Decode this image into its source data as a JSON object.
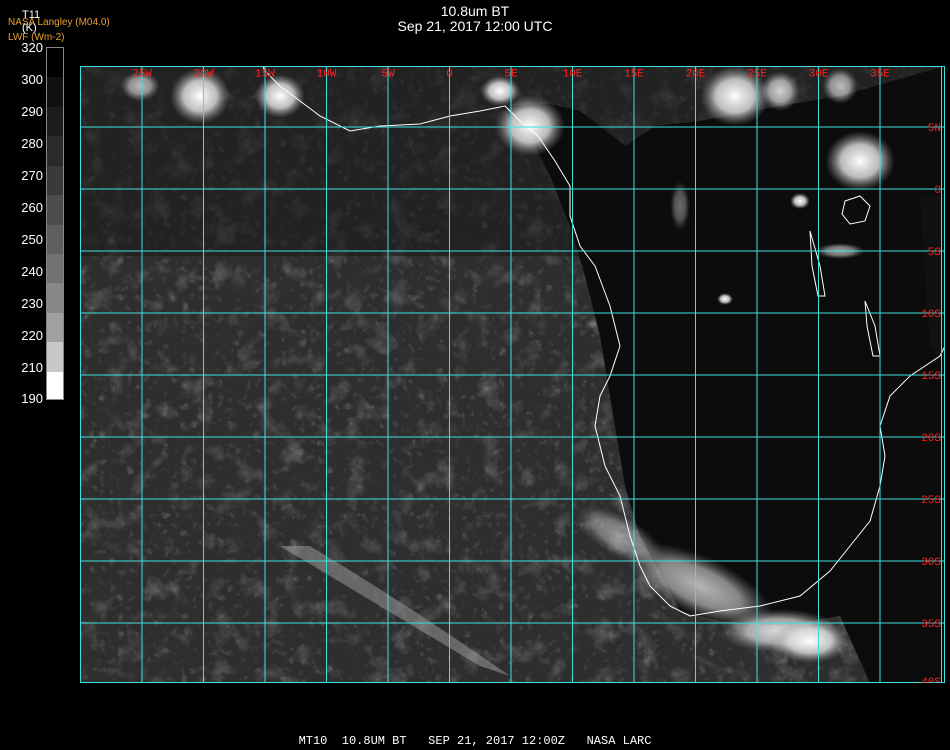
{
  "header": {
    "title": "10.8um BT",
    "subtitle": "Sep 21, 2017 12:00 UTC"
  },
  "credits": {
    "line1": "NASA Langley (M04.0)",
    "line2": "LWF (Wm-2)"
  },
  "colorbar": {
    "title": "T11",
    "unit": "(K)",
    "labels": [
      "320",
      "300",
      "290",
      "280",
      "270",
      "260",
      "250",
      "240",
      "230",
      "220",
      "210",
      "190"
    ],
    "levels": [
      "#000000",
      "#101010",
      "#1c1c1c",
      "#2a2a2a",
      "#3a3a3a",
      "#4c4c4c",
      "#5e5e5e",
      "#727272",
      "#888888",
      "#a0a0a0",
      "#c8c8c8",
      "#ffffff"
    ]
  },
  "map": {
    "grid_color": "#40e0e0",
    "label_color": "#ff2020",
    "coast_color": "#ffffff",
    "lon_labels": [
      "25W",
      "20W",
      "15W",
      "10W",
      "5W",
      "0",
      "5E",
      "10E",
      "15E",
      "20E",
      "25E",
      "30E",
      "35E"
    ],
    "lat_labels": [
      "5N",
      "0",
      "5S",
      "10S",
      "15S",
      "20S",
      "25S",
      "30S",
      "35S",
      "40S"
    ]
  },
  "footer": {
    "text": "MT10  10.8UM BT   SEP 21, 2017 12:00Z   NASA LARC"
  }
}
